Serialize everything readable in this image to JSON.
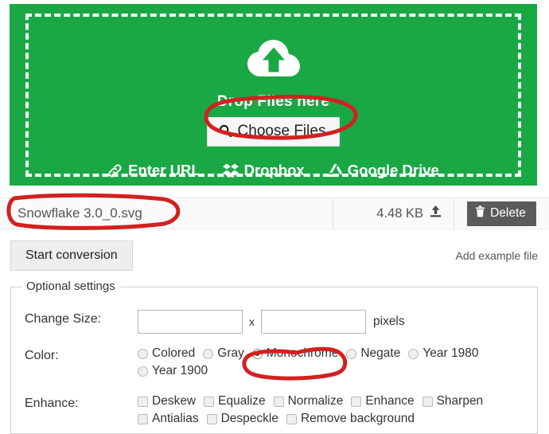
{
  "dropzone": {
    "cloud_icon": "cloud-upload-icon",
    "drop_label": "Drop Files here",
    "choose_files_label": "Choose Files",
    "choose_files_icon": "search-icon",
    "services": [
      {
        "label": "Enter URL",
        "icon": "link-icon"
      },
      {
        "label": "Dropbox",
        "icon": "dropbox-icon"
      },
      {
        "label": "Google Drive",
        "icon": "google-drive-icon"
      }
    ],
    "background_color": "#1aa844"
  },
  "file_row": {
    "file_name": "Snowflake 3.0_0.svg",
    "file_size": "4.48 KB",
    "upload_icon": "upload-icon",
    "delete_label": "Delete",
    "delete_icon": "trash-icon"
  },
  "action_bar": {
    "start_conversion_label": "Start conversion",
    "add_example_file_label": "Add example file"
  },
  "optional_settings": {
    "legend": "Optional settings",
    "change_size": {
      "label": "Change Size:",
      "width_value": "",
      "height_value": "",
      "width_placeholder": "",
      "height_placeholder": "",
      "separator": "x",
      "unit": "pixels"
    },
    "color": {
      "label": "Color:",
      "selected": "Monochrome",
      "options": [
        {
          "label": "Colored",
          "checked": false
        },
        {
          "label": "Gray",
          "checked": false
        },
        {
          "label": "Monochrome",
          "checked": true
        },
        {
          "label": "Negate",
          "checked": false
        },
        {
          "label": "Year 1980",
          "checked": false
        },
        {
          "label": "Year 1900",
          "checked": false
        }
      ]
    },
    "enhance": {
      "label": "Enhance:",
      "options": [
        {
          "label": "Deskew",
          "checked": false
        },
        {
          "label": "Equalize",
          "checked": false
        },
        {
          "label": "Normalize",
          "checked": false
        },
        {
          "label": "Enhance",
          "checked": false
        },
        {
          "label": "Sharpen",
          "checked": false
        },
        {
          "label": "Antialias",
          "checked": false
        },
        {
          "label": "Despeckle",
          "checked": false
        },
        {
          "label": "Remove background",
          "checked": false
        }
      ]
    }
  },
  "annotations": {
    "color": "#d32020",
    "shapes": [
      {
        "name": "choose-files-highlight",
        "target": "Choose Files"
      },
      {
        "name": "file-name-highlight",
        "target": "Snowflake 3.0_0.svg"
      },
      {
        "name": "monochrome-highlight",
        "target": "Monochrome"
      }
    ]
  }
}
